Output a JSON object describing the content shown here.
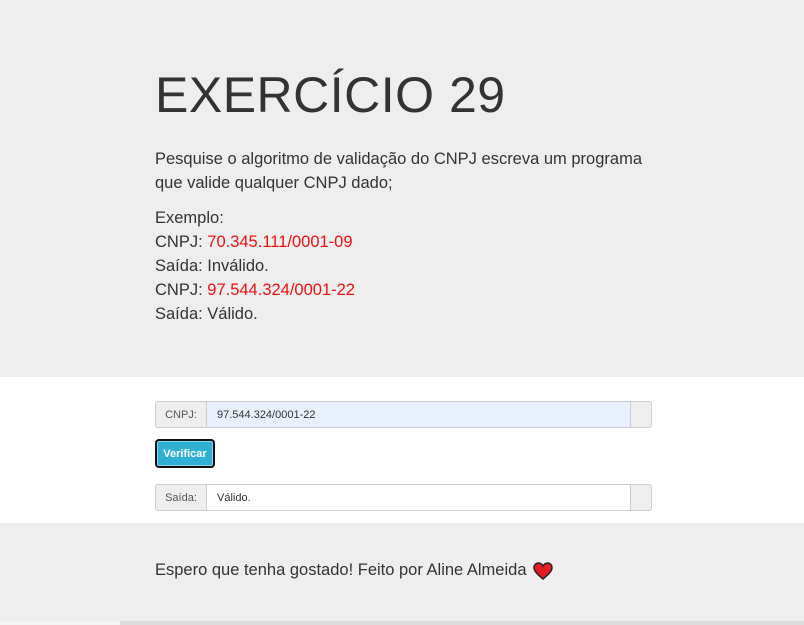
{
  "hero": {
    "title": "EXERCÍCIO 29",
    "description": "Pesquise o algoritmo de validação do CNPJ escreva um programa que valide qualquer CNPJ dado;",
    "example_label": "Exemplo:",
    "examples": [
      {
        "cnpj_label": "CNPJ: ",
        "cnpj_value": "70.345.111/0001-09",
        "saida_label": "Saída: ",
        "saida_value": "Inválido."
      },
      {
        "cnpj_label": "CNPJ: ",
        "cnpj_value": "97.544.324/0001-22",
        "saida_label": "Saída: ",
        "saida_value": "Válido."
      }
    ]
  },
  "form": {
    "cnpj_addon": "CNPJ:",
    "cnpj_value": "97.544.324/0001-22",
    "button_label": "Verificar",
    "saida_addon": "Saída:",
    "saida_value": "Válido."
  },
  "footer": {
    "text": "Espero que tenha gostado! Feito por Aline Almeida",
    "icon": "heart-icon"
  },
  "colors": {
    "accent": "#31b0d5",
    "highlight": "#ee1111",
    "heart": "#e51c23"
  }
}
